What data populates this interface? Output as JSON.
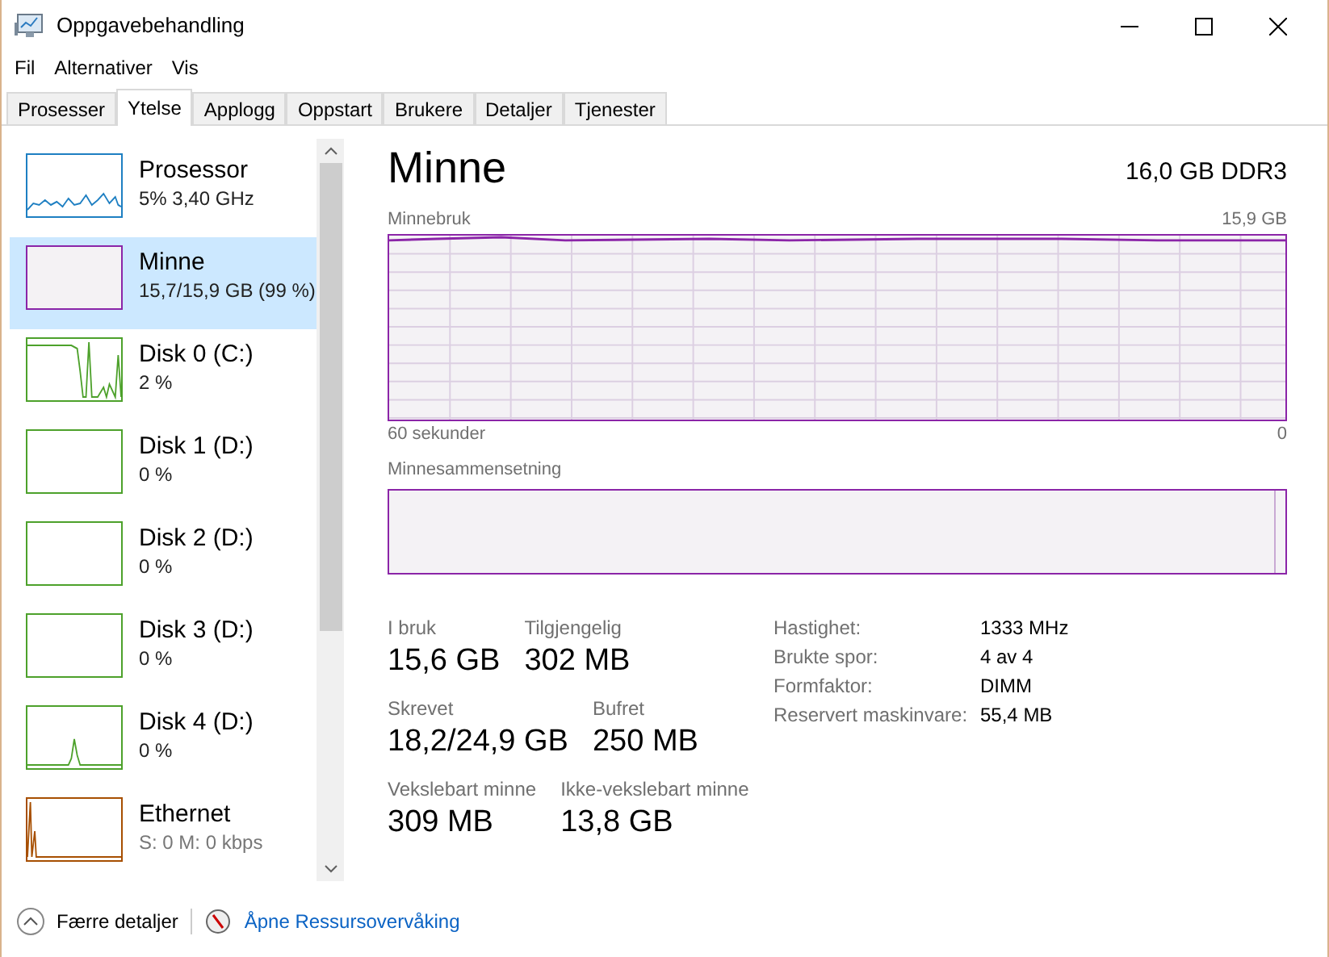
{
  "window": {
    "title": "Oppgavebehandling"
  },
  "menu": [
    "Fil",
    "Alternativer",
    "Vis"
  ],
  "tabs": [
    {
      "label": "Prosesser",
      "selected": false
    },
    {
      "label": "Ytelse",
      "selected": true
    },
    {
      "label": "Applogg",
      "selected": false
    },
    {
      "label": "Oppstart",
      "selected": false
    },
    {
      "label": "Brukere",
      "selected": false
    },
    {
      "label": "Detaljer",
      "selected": false
    },
    {
      "label": "Tjenester",
      "selected": false
    }
  ],
  "sidebar": {
    "items": [
      {
        "name": "Prosessor",
        "detail": "5% 3,40 GHz",
        "color": "#1e7fc2",
        "selected": false
      },
      {
        "name": "Minne",
        "detail": "15,7/15,9 GB (99 %)",
        "color": "#8b25a8",
        "selected": true
      },
      {
        "name": "Disk 0 (C:)",
        "detail": "2 %",
        "color": "#4da12b",
        "selected": false
      },
      {
        "name": "Disk 1 (D:)",
        "detail": "0 %",
        "color": "#4da12b",
        "selected": false
      },
      {
        "name": "Disk 2 (D:)",
        "detail": "0 %",
        "color": "#4da12b",
        "selected": false
      },
      {
        "name": "Disk 3 (D:)",
        "detail": "0 %",
        "color": "#4da12b",
        "selected": false
      },
      {
        "name": "Disk 4 (D:)",
        "detail": "0 %",
        "color": "#4da12b",
        "selected": false
      },
      {
        "name": "Ethernet",
        "detail": "S: 0 M: 0 kbps",
        "color": "#a74f01",
        "selected": false
      }
    ]
  },
  "panel": {
    "title": "Minne",
    "spec": "16,0 GB DDR3",
    "usage_graph": {
      "label": "Minnebruk",
      "max": "15,9 GB",
      "start": "60 sekunder",
      "end": "0"
    },
    "composition": {
      "label": "Minnesammensetning"
    },
    "stats": [
      [
        {
          "label": "I bruk",
          "value": "15,6 GB"
        },
        {
          "label": "Tilgjengelig",
          "value": "302 MB"
        }
      ],
      [
        {
          "label": "Skrevet",
          "value": "18,2/24,9 GB"
        },
        {
          "label": "Bufret",
          "value": "250 MB"
        }
      ],
      [
        {
          "label": "Vekslebart minne",
          "value": "309 MB"
        },
        {
          "label": "Ikke-vekslebart minne",
          "value": "13,8 GB"
        }
      ]
    ],
    "details": [
      {
        "label": "Hastighet:",
        "value": "1333 MHz"
      },
      {
        "label": "Brukte spor:",
        "value": "4 av 4"
      },
      {
        "label": "Formfaktor:",
        "value": "DIMM"
      },
      {
        "label": "Reservert maskinvare:",
        "value": "55,4 MB"
      }
    ]
  },
  "footer": {
    "fewer": "Færre detaljer",
    "monitor_link": "Åpne Ressursovervåking"
  }
}
